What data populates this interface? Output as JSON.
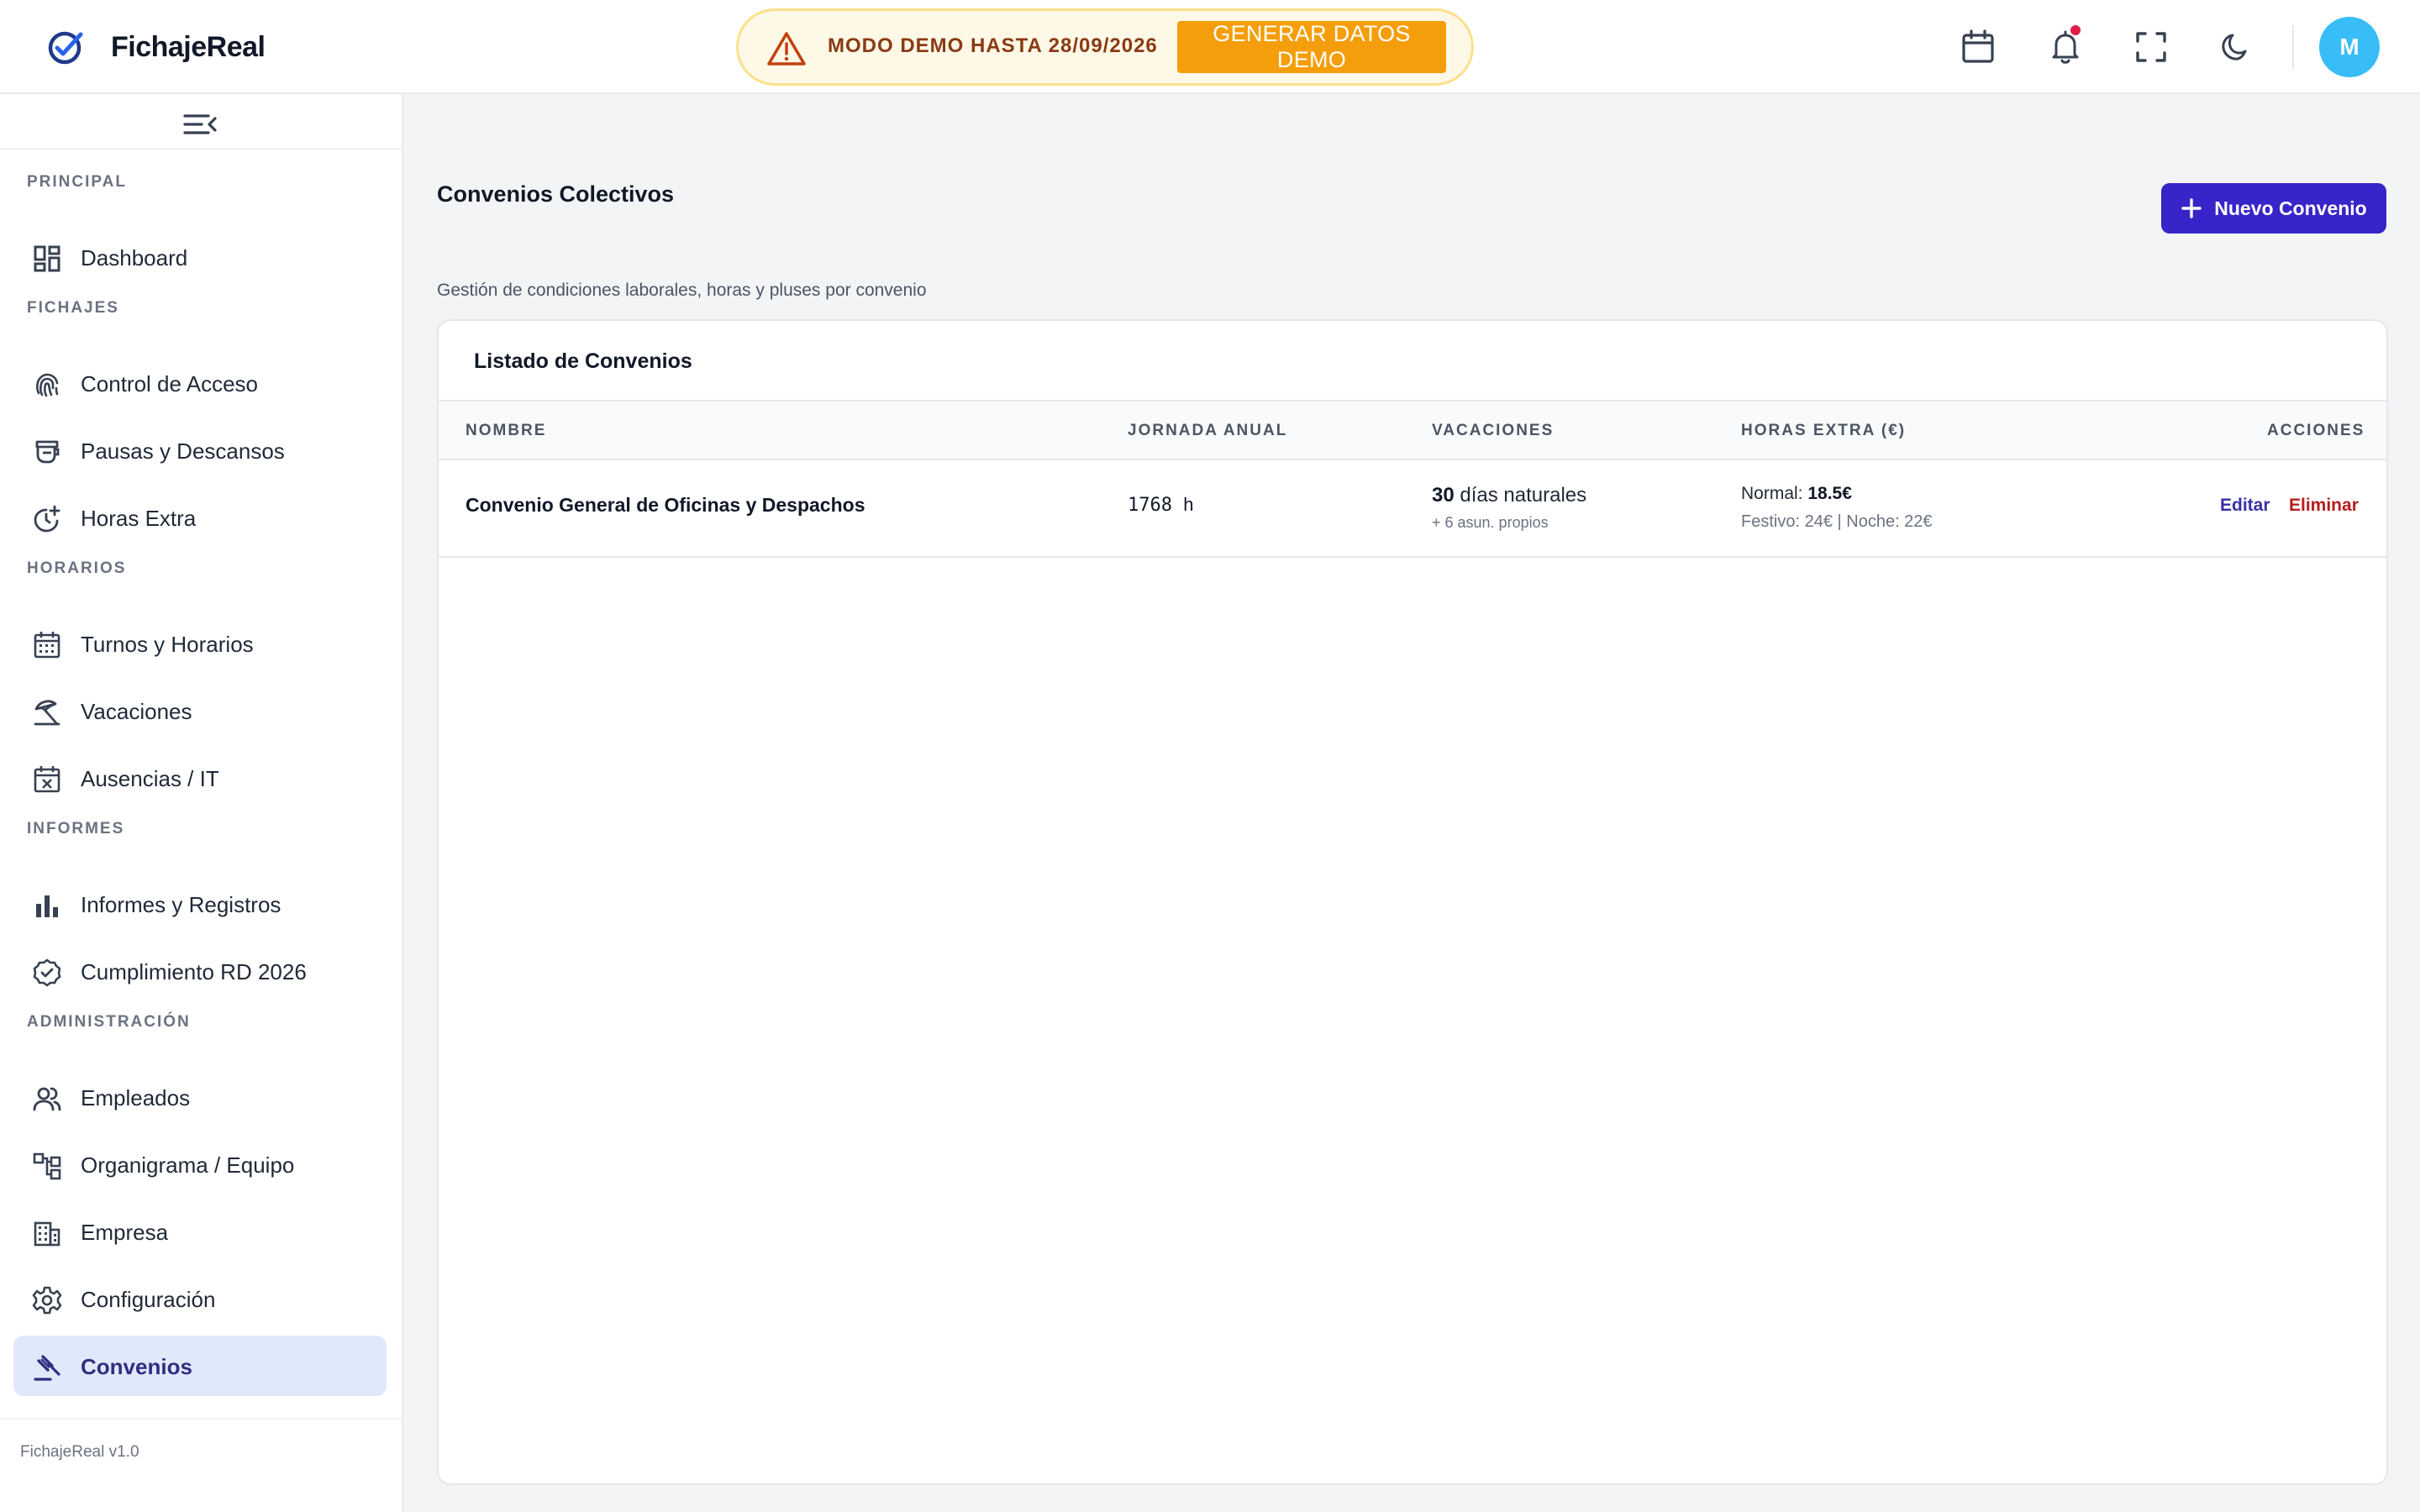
{
  "header": {
    "brand": "FichajeReal",
    "demo_text": "MODO DEMO HASTA 28/09/2026",
    "demo_button": "GENERAR DATOS DEMO",
    "avatar_initial": "M",
    "icons": [
      "calendar-icon",
      "bell-icon",
      "fullscreen-icon",
      "moon-icon"
    ],
    "notification_dot_color": "#e11d48"
  },
  "sidebar": {
    "sections": {
      "principal": "PRINCIPAL",
      "fichajes": "FICHAJES",
      "horarios": "HORARIOS",
      "informes": "INFORMES",
      "administracion": "ADMINISTRACIÓN"
    },
    "items": {
      "dashboard": "Dashboard",
      "control_acceso": "Control de Acceso",
      "pausas": "Pausas y Descansos",
      "horas_extra": "Horas Extra",
      "turnos": "Turnos y Horarios",
      "vacaciones": "Vacaciones",
      "ausencias": "Ausencias / IT",
      "informes": "Informes y Registros",
      "cumplimiento": "Cumplimiento RD 2026",
      "empleados": "Empleados",
      "organigrama": "Organigrama / Equipo",
      "empresa": "Empresa",
      "configuracion": "Configuración",
      "convenios": "Convenios"
    },
    "active_item": "Convenios",
    "version": "FichajeReal v1.0"
  },
  "main": {
    "title": "Convenios Colectivos",
    "subtitle": "Gestión de condiciones laborales, horas y pluses por convenio",
    "new_button": "Nuevo Convenio",
    "card_title": "Listado de Convenios",
    "columns": {
      "nombre": "NOMBRE",
      "jornada": "JORNADA ANUAL",
      "vacaciones": "VACACIONES",
      "horas_extra": "HORAS EXTRA (€)",
      "acciones": "ACCIONES"
    },
    "rows": [
      {
        "nombre": "Convenio General de Oficinas y Despachos",
        "jornada_value": "1768",
        "jornada_unit": "h",
        "vac_days": "30",
        "vac_label": "días naturales",
        "vac_extra": "+ 6 asun. propios",
        "he_label": "Normal:",
        "he_value": "18.5€",
        "he_extra": "Festivo: 24€ | Noche: 22€",
        "edit_label": "Editar",
        "delete_label": "Eliminar"
      }
    ]
  },
  "colors": {
    "primary": "#3725c9",
    "demo_bg": "#fef8e7",
    "demo_button": "#f59e0b",
    "avatar": "#38bdf8",
    "active_nav_bg": "#e0e9fb",
    "delete": "#b91c1c"
  }
}
